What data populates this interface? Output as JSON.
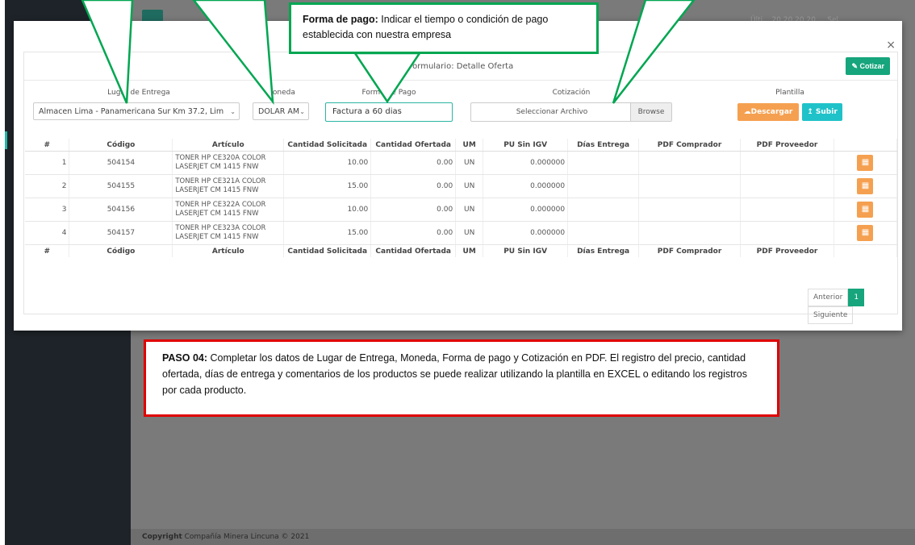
{
  "footer": {
    "copyright_bold": "Copyright",
    "copyright_text": " Compañía Minera Lincuna © 2021"
  },
  "topbar": {
    "text": "Últi... 20 20 20 20 ... Sel"
  },
  "modal": {
    "close": "×",
    "title": "Formulario: Detalle Oferta",
    "cotizar_label": "Cotizar",
    "labels": {
      "lugar": "Lugar de Entrega",
      "moneda": "Moneda",
      "forma_pago": "Forma de Pago",
      "cotizacion": "Cotización",
      "plantilla": "Plantilla"
    },
    "lugar_value": "Almacen Lima - Panamericana Sur Km 37.2, Lim",
    "moneda_value": "DOLAR AM",
    "forma_pago_value": "Factura a  60 dias",
    "file_placeholder": "Seleccionar Archivo",
    "browse_label": "Browse",
    "descargar_label": "Descargar",
    "subir_label": "Subir"
  },
  "table": {
    "headers": [
      "#",
      "Código",
      "Artículo",
      "Cantidad Solicitada",
      "Cantidad Ofertada",
      "UM",
      "PU Sin IGV",
      "Días Entrega",
      "PDF Comprador",
      "PDF Proveedor",
      ""
    ],
    "rows": [
      {
        "n": "1",
        "codigo": "504154",
        "articulo": "TONER HP CE320A COLOR LASERJET CM 1415 FNW",
        "solicitada": "10.00",
        "ofertada": "0.00",
        "um": "UN",
        "pu": "0.000000"
      },
      {
        "n": "2",
        "codigo": "504155",
        "articulo": "TONER HP CE321A COLOR LASERJET CM 1415 FNW",
        "solicitada": "15.00",
        "ofertada": "0.00",
        "um": "UN",
        "pu": "0.000000"
      },
      {
        "n": "3",
        "codigo": "504156",
        "articulo": "TONER HP CE322A COLOR LASERJET CM 1415 FNW",
        "solicitada": "10.00",
        "ofertada": "0.00",
        "um": "UN",
        "pu": "0.000000"
      },
      {
        "n": "4",
        "codigo": "504157",
        "articulo": "TONER HP CE323A COLOR LASERJET CM 1415 FNW",
        "solicitada": "15.00",
        "ofertada": "0.00",
        "um": "UN",
        "pu": "0.000000"
      }
    ]
  },
  "pager": {
    "prev": "Anterior",
    "current": "1",
    "next": "Siguiente"
  },
  "callouts": {
    "top_bold": "Forma de pago:",
    "top_text": " Indicar el tiempo o condición de pago establecida con nuestra empresa",
    "bottom_bold": "PASO 04:",
    "bottom_text": " Completar los datos de Lugar de Entrega, Moneda, Forma de pago y Cotización en PDF. El registro del precio, cantidad ofertada, días de entrega y comentarios de los productos se puede realizar utilizando la plantilla en EXCEL o editando los registros por cada producto."
  },
  "colors": {
    "accent": "#16a57c",
    "orange": "#f5a050",
    "teal": "#1fc2c8",
    "callout_green": "#00a651",
    "callout_red": "#e00000"
  }
}
